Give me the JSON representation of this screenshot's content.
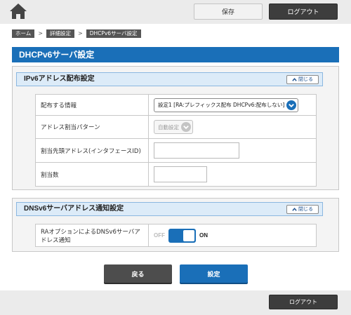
{
  "header": {
    "home_icon": "home-icon",
    "save_label": "保存",
    "logout_label": "ログアウト"
  },
  "breadcrumb": [
    {
      "label": "ホーム"
    },
    {
      "label": "詳細設定"
    },
    {
      "label": "DHCPv6サーバ設定"
    }
  ],
  "breadcrumb_separator": ">",
  "page_title": "DHCPv6サーバ設定",
  "section1": {
    "title": "IPv6アドレス配布設定",
    "close_label": "閉じる",
    "rows": {
      "distribute_info": {
        "label": "配布する情報",
        "value": "設定1 [RA:プレフィックス配布 DHCPv6:配布しない]"
      },
      "assign_pattern": {
        "label": "アドレス割当パターン",
        "value": "自動設定"
      },
      "start_address": {
        "label": "割当先頭アドレス(インタフェースID)",
        "value": ""
      },
      "assign_count": {
        "label": "割当数",
        "value": ""
      }
    }
  },
  "section2": {
    "title": "DNSv6サーバアドレス通知設定",
    "close_label": "閉じる",
    "ra_option": {
      "label": "RAオプションによるDNSv6サーバアドレス通知",
      "off_label": "OFF",
      "on_label": "ON",
      "state": "ON"
    }
  },
  "actions": {
    "back_label": "戻る",
    "submit_label": "設定"
  },
  "footer": {
    "logout_label": "ログアウト"
  },
  "colors": {
    "accent": "#1a6fb8",
    "dark_button": "#3d3d3d",
    "section_head_bg": "#dcebf8"
  }
}
